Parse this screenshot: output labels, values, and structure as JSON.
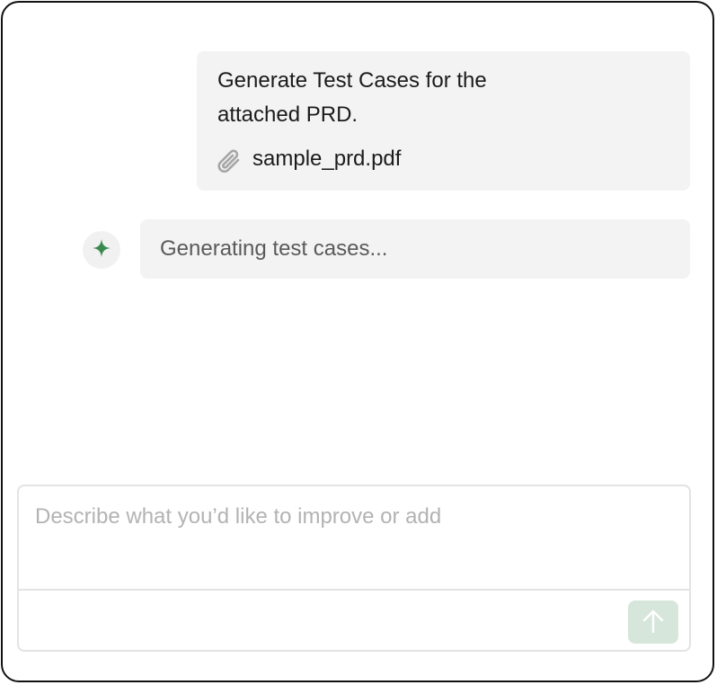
{
  "conversation": {
    "user_message": {
      "text": "Generate Test Cases for the attached PRD.",
      "attachment": {
        "icon": "paperclip-icon",
        "name": "sample_prd.pdf"
      }
    },
    "assistant_message": {
      "icon": "sparkle-icon",
      "text": "Generating test cases..."
    }
  },
  "composer": {
    "placeholder": "Describe what you’d like to improve or add",
    "value": "",
    "send_icon": "arrow-up-icon",
    "send_button_color": "#d6e6db"
  },
  "colors": {
    "accent": "#3a8a4f",
    "bubble_bg": "#f3f3f3",
    "border": "#111111"
  }
}
